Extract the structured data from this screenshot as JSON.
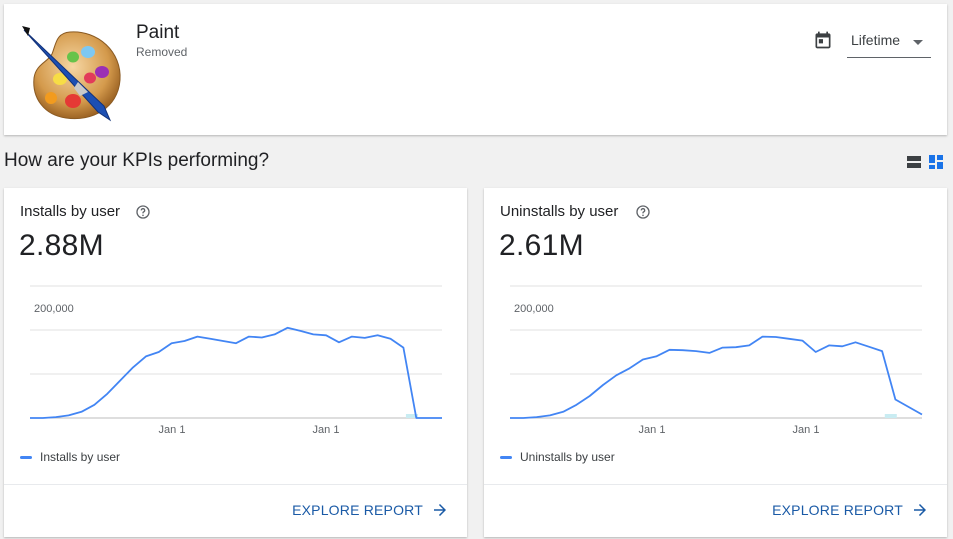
{
  "app": {
    "name": "Paint",
    "status": "Removed",
    "icon": "paint-palette-icon"
  },
  "date_range": {
    "label": "Lifetime",
    "icon": "calendar-icon"
  },
  "section": {
    "title": "How are your KPIs performing?",
    "view_icons": [
      "view-list-icon",
      "view-grid-icon"
    ]
  },
  "colors": {
    "series": "#4285f4",
    "link": "#1a5aa6",
    "selected_view": "#1a73e8"
  },
  "cards": [
    {
      "title": "Installs by user",
      "value": "2.88M",
      "legend": "Installs by user",
      "explore_label": "EXPLORE REPORT"
    },
    {
      "title": "Uninstalls by user",
      "value": "2.61M",
      "legend": "Uninstalls by user",
      "explore_label": "EXPLORE REPORT"
    }
  ],
  "chart_data": [
    {
      "type": "line",
      "y_tick_label": "200,000",
      "x_tick_labels": [
        "Jan 1",
        "Jan 1"
      ],
      "ylim": [
        0,
        300000
      ],
      "grid": true,
      "series": [
        {
          "name": "Installs by user",
          "values": [
            0,
            0,
            2000,
            6000,
            14000,
            30000,
            55000,
            85000,
            115000,
            140000,
            150000,
            170000,
            175000,
            185000,
            180000,
            175000,
            170000,
            185000,
            183000,
            190000,
            205000,
            198000,
            190000,
            188000,
            172000,
            185000,
            182000,
            188000,
            180000,
            160000,
            0,
            0,
            0
          ]
        }
      ]
    },
    {
      "type": "line",
      "y_tick_label": "200,000",
      "x_tick_labels": [
        "Jan 1",
        "Jan 1"
      ],
      "ylim": [
        0,
        300000
      ],
      "grid": true,
      "series": [
        {
          "name": "Uninstalls by user",
          "values": [
            0,
            0,
            2000,
            6000,
            14000,
            30000,
            50000,
            75000,
            97000,
            113000,
            133000,
            140000,
            155000,
            154000,
            152000,
            148000,
            160000,
            161000,
            165000,
            185000,
            184000,
            180000,
            176000,
            150000,
            165000,
            163000,
            172000,
            162000,
            152000,
            42000,
            25000,
            8000
          ]
        }
      ]
    }
  ]
}
